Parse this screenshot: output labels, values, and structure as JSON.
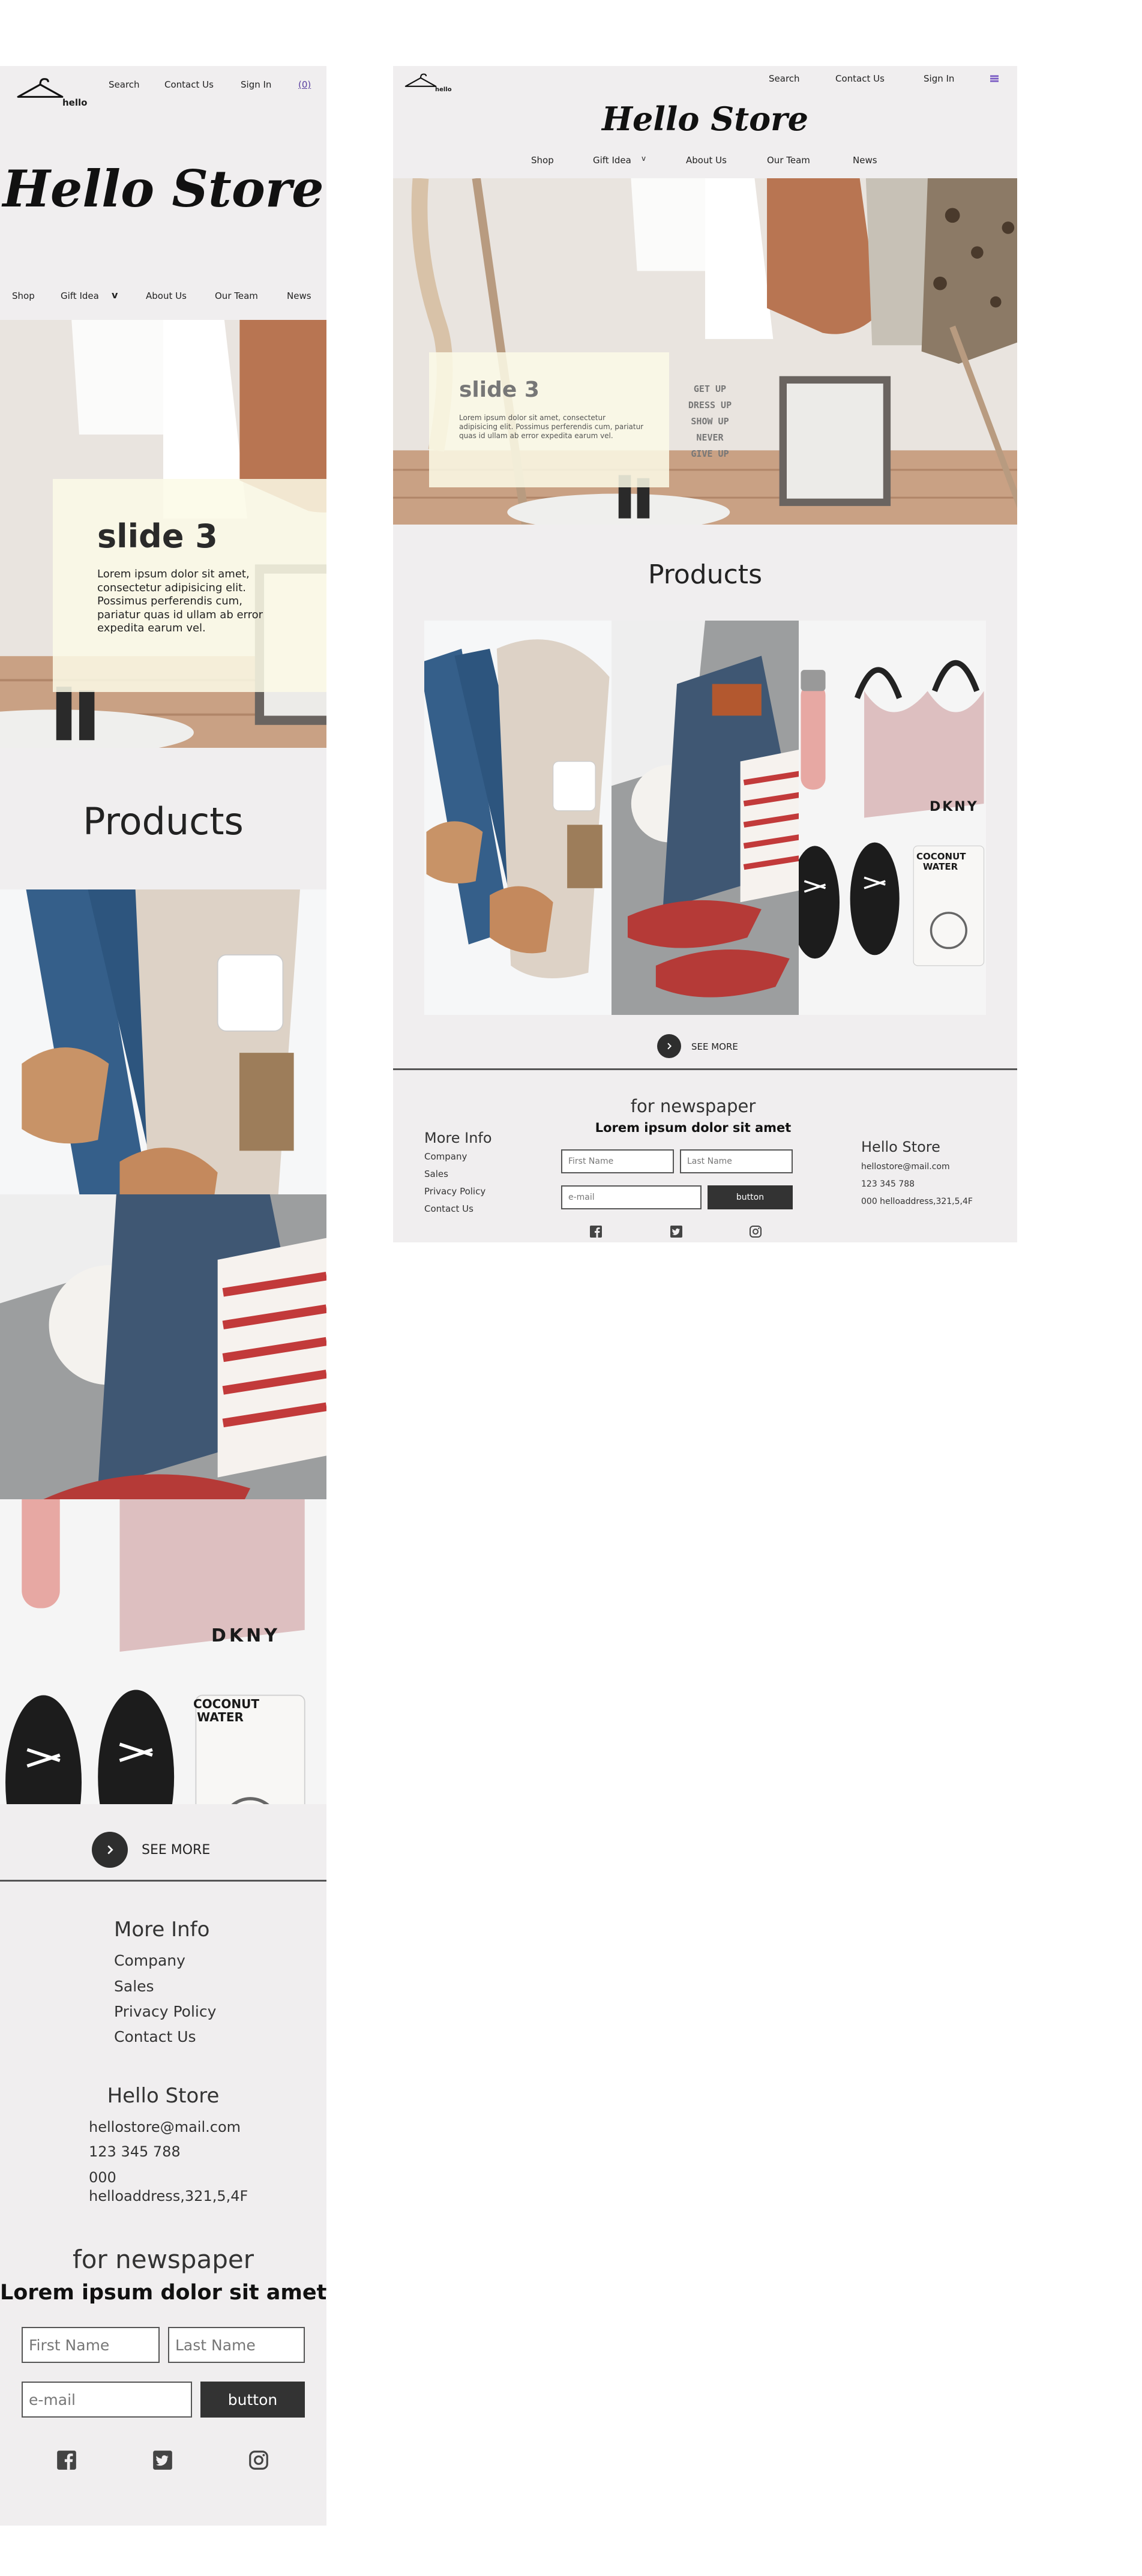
{
  "brand": {
    "logo_word": "hello",
    "title": "Hello Store"
  },
  "header": {
    "search": "Search",
    "contact": "Contact Us",
    "signin": "Sign In",
    "cart": "(0)"
  },
  "nav": {
    "shop": "Shop",
    "gift": "Gift Idea",
    "gift_caret": "v",
    "about": "About Us",
    "team": "Our Team",
    "news": "News"
  },
  "slide": {
    "title": "slide 3",
    "body": "Lorem ipsum dolor sit amet, consectetur adipisicing elit. Possimus perferendis cum, pariatur quas id ullam ab error expedita earum vel."
  },
  "letterboard": [
    "GET UP",
    "DRESS UP",
    "SHOW UP",
    "NEVER",
    "GIVE UP"
  ],
  "products": {
    "heading": "Products",
    "see_more": "SEE MORE"
  },
  "product_print": {
    "brand": "DKNY",
    "drink": "COCONUT WATER"
  },
  "footer": {
    "more_info": {
      "title": "More Info",
      "links": [
        "Company",
        "Sales",
        "Privacy Policy",
        "Contact Us"
      ]
    },
    "store": {
      "title": "Hello Store",
      "email": "hellostore@mail.com",
      "phone": "123 345 788",
      "address": "000 helloaddress,321,5,4F"
    },
    "newsletter": {
      "title": "for newspaper",
      "subtitle": "Lorem ipsum dolor sit amet",
      "first_name": "First Name",
      "last_name": "Last Name",
      "email": "e-mail",
      "button": "button"
    },
    "social": [
      "facebook-icon",
      "twitter-icon",
      "instagram-icon"
    ]
  },
  "colors": {
    "panel": "#f0eeef",
    "dark": "#333333",
    "slide_bg": "#fcfae6",
    "cart": "#5a3fa0"
  }
}
